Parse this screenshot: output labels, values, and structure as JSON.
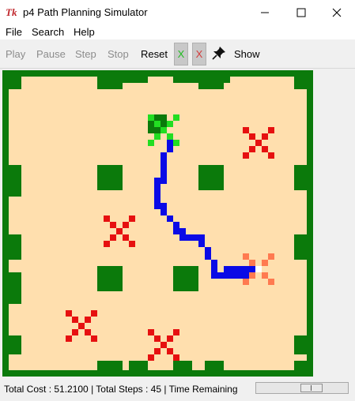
{
  "window": {
    "title": "p4 Path Planning Simulator",
    "app_icon_text": "Tk"
  },
  "menu": {
    "items": [
      "File",
      "Search",
      "Help"
    ]
  },
  "toolbar": {
    "play_label": "Play",
    "pause_label": "Pause",
    "step_label": "Step",
    "stop_label": "Stop",
    "reset_label": "Reset",
    "start_marker_label": "X",
    "goal_marker_label": "X",
    "show_label": "Show",
    "pin_icon": "pushpin-icon"
  },
  "status": {
    "text": "Total Cost : 51.2100 | Total Steps : 45 | Time Remaining",
    "progress_fraction": 0.63
  },
  "colors": {
    "wall": "#0b7a0b",
    "floor": "#ffdfae",
    "path": "#0a0ae6",
    "start": "#22dd22",
    "goal": "#ff7a50",
    "obstacle_x": "#e61010",
    "start_marker_text": "#22bb22",
    "goal_marker_text": "#d43c3c"
  }
}
